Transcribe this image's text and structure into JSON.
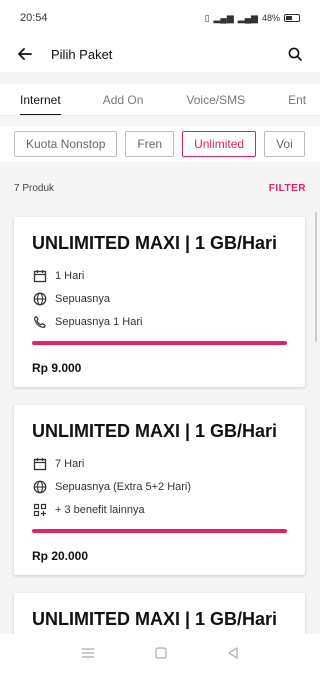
{
  "status_bar": {
    "time": "20:54",
    "battery_percent": "48%"
  },
  "header": {
    "title": "Pilih Paket"
  },
  "tabs": [
    {
      "label": "Internet",
      "active": true
    },
    {
      "label": "Add On",
      "active": false
    },
    {
      "label": "Voice/SMS",
      "active": false
    },
    {
      "label": "Ent",
      "active": false
    }
  ],
  "chips": [
    {
      "label": "Kuota Nonstop",
      "active": false
    },
    {
      "label": "Fren",
      "active": false
    },
    {
      "label": "Unlimited",
      "active": true
    },
    {
      "label": "Voi",
      "active": false
    }
  ],
  "list": {
    "count": "7 Produk",
    "filter_label": "FILTER"
  },
  "products": [
    {
      "title": "UNLIMITED MAXI | 1 GB/Hari",
      "rows": [
        {
          "icon": "calendar-icon",
          "text": "1 Hari"
        },
        {
          "icon": "globe-icon",
          "text": "Sepuasnya"
        },
        {
          "icon": "phone-icon",
          "text": "Sepuasnya 1 Hari"
        }
      ],
      "price": "Rp 9.000"
    },
    {
      "title": "UNLIMITED MAXI | 1 GB/Hari",
      "rows": [
        {
          "icon": "calendar-icon",
          "text": "7 Hari"
        },
        {
          "icon": "globe-icon",
          "text": "Sepuasnya (Extra 5+2 Hari)"
        },
        {
          "icon": "apps-plus-icon",
          "text": "+ 3 benefit lainnya"
        }
      ],
      "price": "Rp 20.000"
    },
    {
      "title": "UNLIMITED MAXI | 1 GB/Hari"
    }
  ],
  "colors": {
    "accent": "#e0245e"
  }
}
